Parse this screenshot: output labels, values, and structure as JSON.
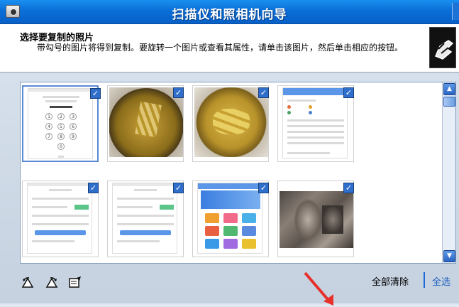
{
  "window": {
    "title": "扫描仪和照相机向导"
  },
  "header": {
    "title": "选择要复制的照片",
    "description": "带勾号的图片将得到复制。要旋转一个图片或查看其属性，请单击该图片，然后单击相应的按钮。"
  },
  "thumbnails": [
    {
      "name": "keypad-screenshot",
      "checked": true,
      "selected": true
    },
    {
      "name": "bowl-photo-1",
      "checked": true,
      "selected": false
    },
    {
      "name": "bowl-photo-2",
      "checked": true,
      "selected": false
    },
    {
      "name": "app-list-screenshot",
      "checked": true,
      "selected": false
    },
    {
      "name": "form-screenshot-1",
      "checked": true,
      "selected": false
    },
    {
      "name": "form-screenshot-2",
      "checked": true,
      "selected": false
    },
    {
      "name": "app-grid-screenshot",
      "checked": true,
      "selected": false
    },
    {
      "name": "fabric-photo",
      "checked": true,
      "selected": false
    }
  ],
  "toolbar": {
    "rotate_left_icon": "rotate-left-icon",
    "rotate_right_icon": "rotate-right-icon",
    "properties_icon": "properties-icon",
    "clear_all_label": "全部清除",
    "select_all_label": "全选"
  },
  "colors": {
    "titlebar": "#0a6fd8",
    "checkbox": "#2f6fcb",
    "select_all_link": "#1d5fbf",
    "annotation_arrow": "#e8302a"
  }
}
